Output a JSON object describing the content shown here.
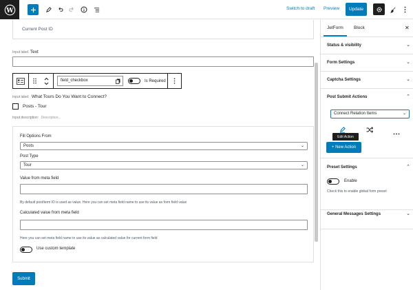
{
  "topbar": {
    "switch_to_draft": "Switch to draft",
    "preview": "Preview",
    "update": "Update"
  },
  "editor": {
    "current_post_id": "Current Post ID",
    "text_field": {
      "label_prefix": "Input label:",
      "label": "Text"
    },
    "block_toolbar": {
      "field_name": "field_checkbox",
      "is_required": "Is Required"
    },
    "checkbox_field": {
      "label_prefix": "Input label:",
      "label": "What Tours Do You Want to Connect?",
      "option": "Posts - Tour",
      "description_prefix": "Input description:",
      "description_placeholder": "Description..."
    },
    "options_panel": {
      "fill_options_label": "Fill Options From",
      "fill_options_value": "Posts",
      "post_type_label": "Post Type",
      "post_type_value": "Tour",
      "value_meta_label": "Value from meta field",
      "value_meta_help": "By default post/term ID is used as value. Here you can set meta field name to use its value as form field value",
      "calc_meta_label": "Calculated value from meta field",
      "calc_meta_help": "Here you can set meta field name to use its value as calculated value for current form field",
      "custom_template_label": "Use custom template"
    },
    "submit": "Submit"
  },
  "sidebar": {
    "tabs": [
      "JetForm",
      "Block"
    ],
    "sections": {
      "status": "Status & visibility",
      "form_settings": "Form Settings",
      "captcha": "Captcha Settings",
      "post_submit": "Post Submit Actions",
      "preset": "Preset Settings",
      "general_messages": "General Messages Settings"
    },
    "action_select": "Connect Relation Items",
    "edit_action_tooltip": "Edit Action",
    "new_action": "+ New Action",
    "preset_enable": "Enable",
    "preset_help": "Check this to enable global form preset"
  },
  "colors": {
    "accent": "#007cba",
    "dark": "#1e1e1e",
    "border": "#e0e0e0"
  }
}
